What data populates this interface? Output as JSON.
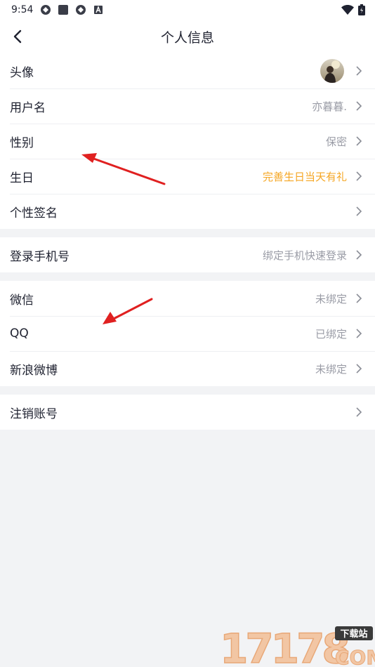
{
  "status_bar": {
    "time": "9:54"
  },
  "header": {
    "title": "个人信息"
  },
  "profile": [
    {
      "label": "头像",
      "value": ""
    },
    {
      "label": "用户名",
      "value": "亦暮暮."
    },
    {
      "label": "性别",
      "value": "保密"
    },
    {
      "label": "生日",
      "value": "完善生日当天有礼"
    },
    {
      "label": "个性签名",
      "value": ""
    }
  ],
  "phone": {
    "label": "登录手机号",
    "value": "绑定手机快速登录"
  },
  "accounts": [
    {
      "label": "微信",
      "value": "未绑定"
    },
    {
      "label": "QQ",
      "value": "已绑定"
    },
    {
      "label": "新浪微博",
      "value": "未绑定"
    }
  ],
  "deactivate": {
    "label": "注销账号"
  },
  "watermark": {
    "number": "17178",
    "tag": "下载站",
    "domain": "COM"
  },
  "colors": {
    "accent": "#f5a623",
    "arrow": "#e02020"
  }
}
